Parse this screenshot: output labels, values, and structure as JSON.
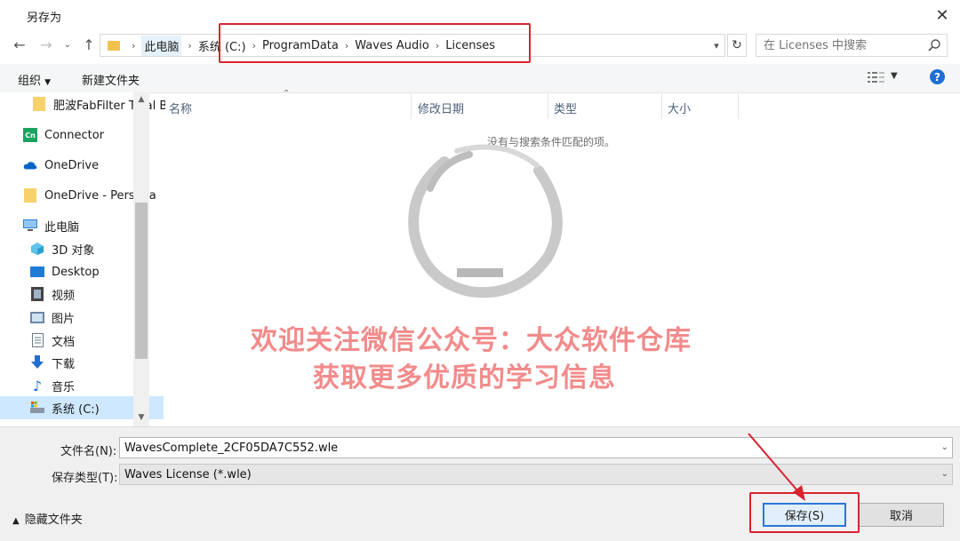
{
  "window": {
    "title": "另存为",
    "close": "✕"
  },
  "address": {
    "crumbs": [
      "此电脑",
      "系统 (C:)",
      "ProgramData",
      "Waves Audio",
      "Licenses"
    ],
    "search_placeholder": "在 Licenses 中搜索"
  },
  "toolbar": {
    "organize": "组织",
    "new_folder": "新建文件夹",
    "help": "?"
  },
  "sidebar": {
    "items": [
      {
        "label": "肥波FabFilter Total Bundle",
        "icon": "folder-icon"
      },
      {
        "label": "Connector",
        "icon": "connector-app-icon"
      },
      {
        "label": "OneDrive",
        "icon": "cloud-icon"
      },
      {
        "label": "OneDrive - Personal",
        "icon": "folder-icon"
      },
      {
        "label": "此电脑",
        "icon": "computer-icon"
      },
      {
        "label": "3D 对象",
        "icon": "cube-icon"
      },
      {
        "label": "Desktop",
        "icon": "desktop-icon"
      },
      {
        "label": "视频",
        "icon": "video-icon"
      },
      {
        "label": "图片",
        "icon": "picture-icon"
      },
      {
        "label": "文档",
        "icon": "document-icon"
      },
      {
        "label": "下载",
        "icon": "download-icon"
      },
      {
        "label": "音乐",
        "icon": "music-icon"
      },
      {
        "label": "系统 (C:)",
        "icon": "drive-icon"
      }
    ],
    "connector_badge": "Cn"
  },
  "filelist": {
    "columns": [
      "名称",
      "修改日期",
      "类型",
      "大小"
    ],
    "empty_message": "没有与搜索条件匹配的项。"
  },
  "watermark": {
    "line1": "欢迎关注微信公众号：大众软件仓库",
    "line2": "获取更多优质的学习信息"
  },
  "footer": {
    "filename_label": "文件名(N):",
    "filename_value": "WavesComplete_2CF05DA7C552.wle",
    "filetype_label": "保存类型(T):",
    "filetype_value": "Waves License (*.wle)",
    "hide_folders": "隐藏文件夹",
    "save": "保存(S)",
    "cancel": "取消"
  },
  "colors": {
    "highlight": "#d9232f",
    "accent": "#2a78d6",
    "watermark_text": "#f28b8b",
    "selection": "#cde8ff"
  }
}
